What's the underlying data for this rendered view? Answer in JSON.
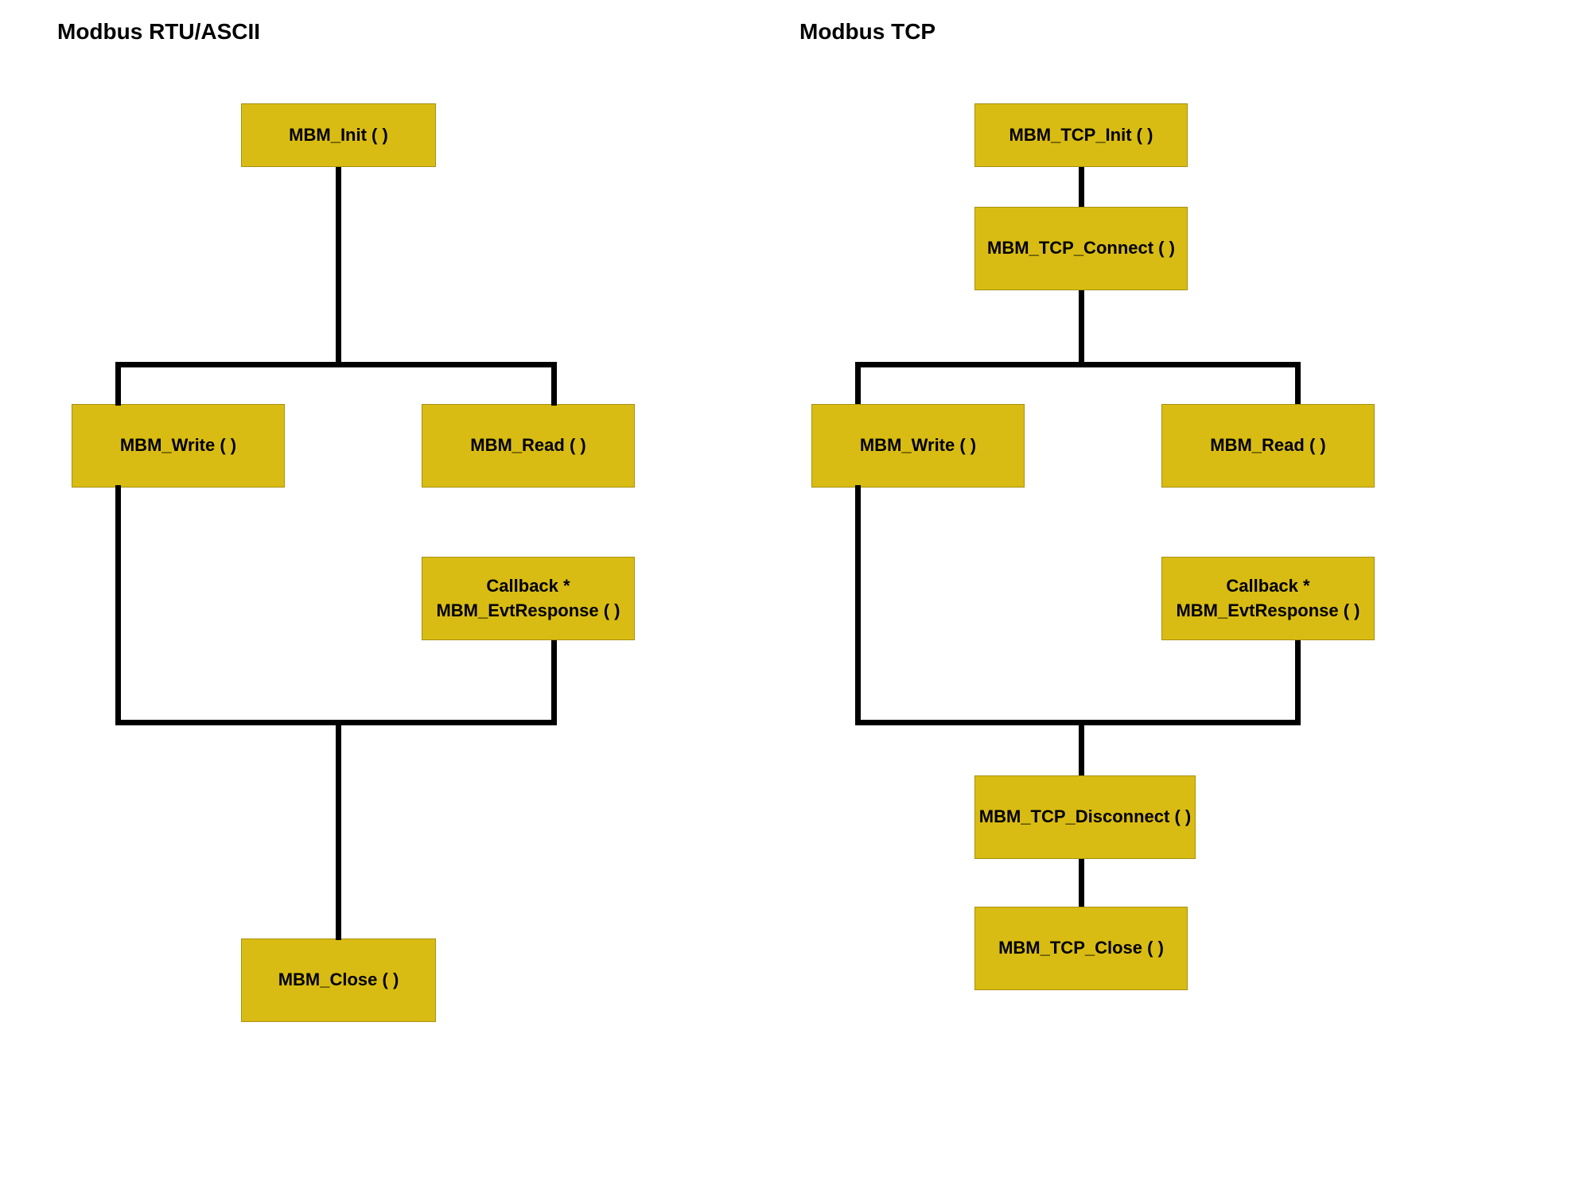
{
  "left": {
    "title": "Modbus RTU/ASCII",
    "init": "MBM_Init ( )",
    "write": "MBM_Write ( )",
    "read": "MBM_Read ( )",
    "callback_line1": "Callback *",
    "callback_line2": "MBM_EvtResponse ( )",
    "close": "MBM_Close ( )"
  },
  "right": {
    "title": "Modbus TCP",
    "init": "MBM_TCP_Init ( )",
    "connect": "MBM_TCP_Connect ( )",
    "write": "MBM_Write ( )",
    "read": "MBM_Read ( )",
    "callback_line1": "Callback *",
    "callback_line2": "MBM_EvtResponse ( )",
    "disconnect": "MBM_TCP_Disconnect ( )",
    "close": "MBM_TCP_Close ( )"
  },
  "colors": {
    "box_fill": "#d9bc13",
    "box_border": "#a8900f",
    "line": "#000000"
  }
}
